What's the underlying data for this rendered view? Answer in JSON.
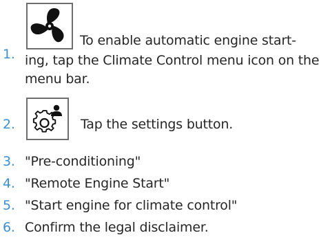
{
  "steps": [
    {
      "number": "1.",
      "icon": "fan-icon",
      "text_line1": "To enable automatic engine start-",
      "text_rest": "ing, tap the Climate Control menu icon on the menu bar."
    },
    {
      "number": "2.",
      "icon": "settings-gear-person-icon",
      "text": "Tap the settings button."
    },
    {
      "number": "3.",
      "text": "\"Pre-conditioning\""
    },
    {
      "number": "4.",
      "text": "\"Remote Engine Start\""
    },
    {
      "number": "5.",
      "text": "\"Start engine for climate control\""
    },
    {
      "number": "6.",
      "text": "Confirm the legal disclaimer."
    }
  ],
  "colors": {
    "number": "#3b8fd4",
    "text": "#262626",
    "icon_border": "#6e6e6e",
    "icon_fill": "#111111"
  }
}
